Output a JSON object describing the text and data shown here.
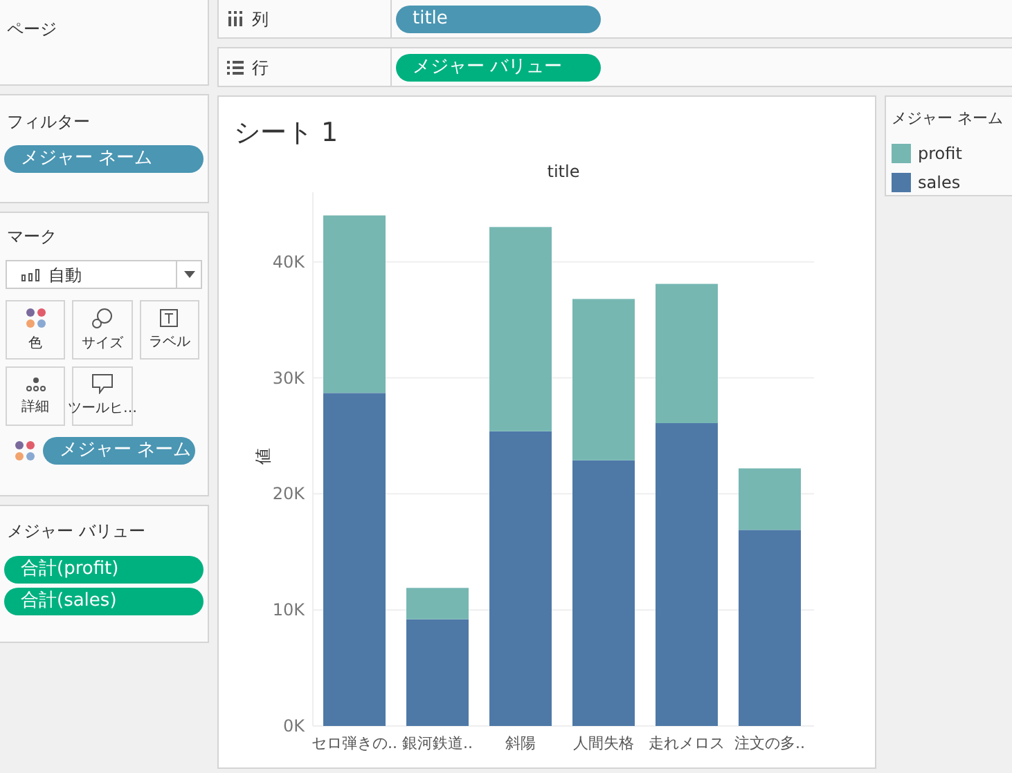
{
  "pages": {
    "label": "ページ"
  },
  "columns_shelf": {
    "label": "列",
    "pills": [
      {
        "label": "title",
        "kind": "dimension"
      }
    ]
  },
  "rows_shelf": {
    "label": "行",
    "pills": [
      {
        "label": "メジャー バリュー",
        "kind": "measure"
      }
    ]
  },
  "filters": {
    "label": "フィルター",
    "pills": [
      {
        "label": "メジャー ネーム",
        "kind": "dimension"
      }
    ]
  },
  "marks": {
    "label": "マーク",
    "mark_type": "自動",
    "cards": [
      {
        "label": "色",
        "kind": "color"
      },
      {
        "label": "サイズ",
        "kind": "size"
      },
      {
        "label": "ラベル",
        "kind": "label"
      },
      {
        "label": "詳細",
        "kind": "detail"
      },
      {
        "label": "ツールヒ…",
        "kind": "tooltip"
      }
    ],
    "fields": [
      {
        "kind": "color",
        "pill": {
          "label": "メジャー ネーム",
          "kind": "dimension"
        }
      }
    ]
  },
  "measure_values": {
    "label": "メジャー バリュー",
    "pills": [
      {
        "label": "合計(profit)",
        "kind": "measure"
      },
      {
        "label": "合計(sales)",
        "kind": "measure"
      }
    ]
  },
  "sheet": {
    "title": "シート 1",
    "chart_data": {
      "type": "bar",
      "stacked": true,
      "title": "title",
      "ylabel": "値",
      "categories": [
        "セロ弾きの..",
        "銀河鉄道..",
        "斜陽",
        "人間失格",
        "走れメロス",
        "注文の多.."
      ],
      "series": [
        {
          "name": "sales",
          "color": "#4e79a7",
          "values": [
            28700,
            9200,
            25400,
            22900,
            26100,
            16900
          ]
        },
        {
          "name": "profit",
          "color": "#76b7b2",
          "values": [
            15300,
            2700,
            17600,
            13900,
            12000,
            5300
          ]
        }
      ],
      "ylim": [
        0,
        46000
      ],
      "grid": true,
      "yticks": [
        {
          "value": 0,
          "label": "0K"
        },
        {
          "value": 10000,
          "label": "10K"
        },
        {
          "value": 20000,
          "label": "20K"
        },
        {
          "value": 30000,
          "label": "30K"
        },
        {
          "value": 40000,
          "label": "40K"
        }
      ]
    }
  },
  "legend": {
    "title": "メジャー ネーム"
  }
}
